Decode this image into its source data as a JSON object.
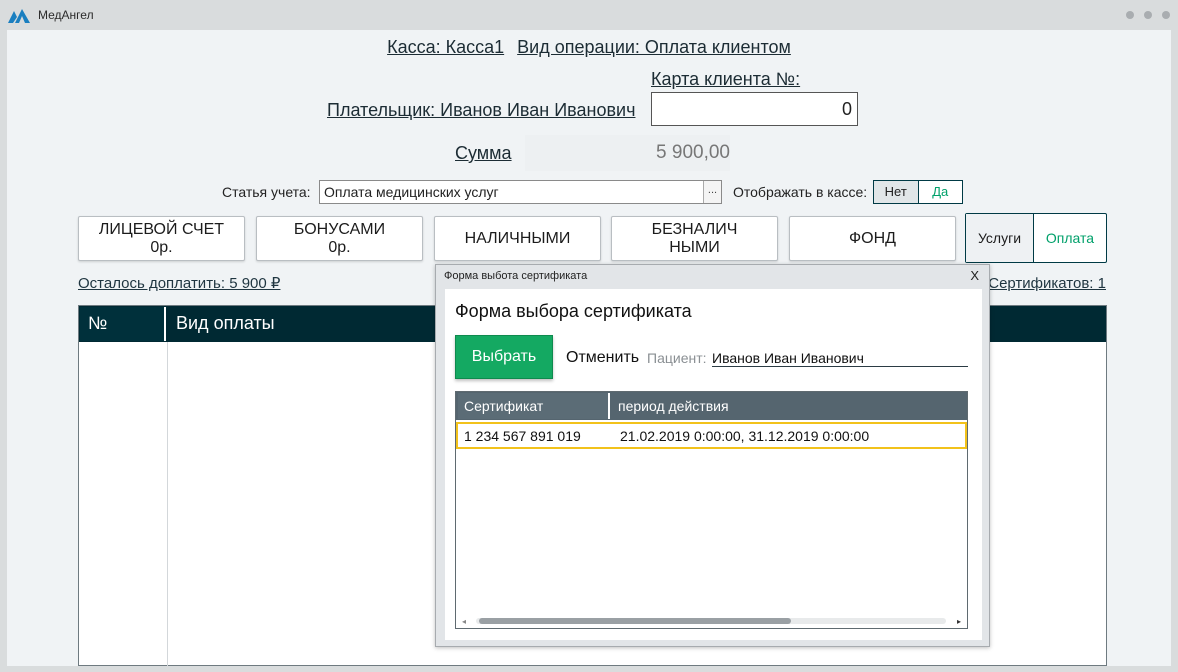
{
  "app": {
    "title": "МедАнгел",
    "brand_color": "#1a7fc0"
  },
  "header": {
    "cashbox": "Касса: Касса1",
    "operation": "Вид операции: Оплата клиентом",
    "client_card_label": "Карта клиента №:",
    "client_card_value": "0",
    "payer": "Плательщик: Иванов Иван Иванович",
    "sum_label": "Сумма",
    "sum_value": "5 900,00"
  },
  "accounting": {
    "label": "Статья учета:",
    "value": "Оплата медицинских услуг",
    "browse_label": "...",
    "show_in_cashbox_label": "Отображать в кассе:",
    "options": [
      "Нет",
      "Да"
    ]
  },
  "payment_buttons": [
    {
      "line1": "ЛИЦЕВОЙ СЧЕТ",
      "line2": "0р."
    },
    {
      "line1": "БОНУСАМИ",
      "line2": "0р."
    },
    {
      "line1": "НАЛИЧНЫМИ",
      "line2": ""
    },
    {
      "line1": "БЕЗНАЛИЧ",
      "line2": "НЫМИ"
    },
    {
      "line1": "ФОНД",
      "line2": ""
    }
  ],
  "segment": {
    "services": "Услуги",
    "payment": "Оплата"
  },
  "remaining": "Осталось доплатить: 5 900 ₽",
  "certificates_count": "Сертификатов:  1",
  "payments_table": {
    "columns": [
      "№",
      "Вид оплаты"
    ]
  },
  "modal": {
    "window_title": "Форма выбота сертификата",
    "close": "X",
    "heading": "Форма выбора сертификата",
    "choose": "Выбрать",
    "cancel": "Отменить",
    "patient_label": "Пациент:",
    "patient_value": "Иванов Иван Иванович",
    "columns": [
      "Сертификат",
      "период действия"
    ],
    "rows": [
      {
        "certificate": "1 234 567 891 019",
        "period": "21.02.2019 0:00:00, 31.12.2019 0:00:00"
      }
    ],
    "scroll_left": "◂",
    "scroll_right": "▸"
  }
}
